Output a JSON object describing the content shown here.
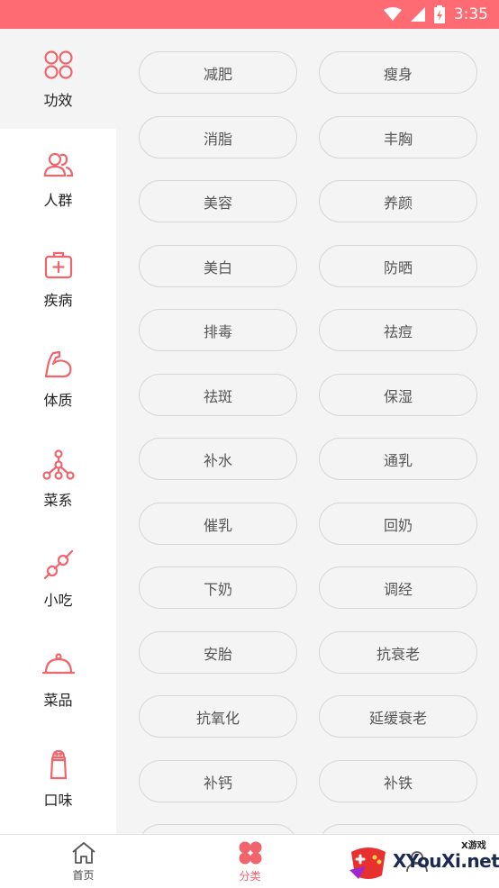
{
  "status_bar": {
    "time": "3:35"
  },
  "sidebar": {
    "items": [
      {
        "label": "功效",
        "icon": "four-circles-icon",
        "active": true
      },
      {
        "label": "人群",
        "icon": "people-icon"
      },
      {
        "label": "疾病",
        "icon": "medical-kit-icon"
      },
      {
        "label": "体质",
        "icon": "muscle-arm-icon"
      },
      {
        "label": "菜系",
        "icon": "tree-network-icon"
      },
      {
        "label": "小吃",
        "icon": "skewer-icon"
      },
      {
        "label": "菜品",
        "icon": "cloche-icon"
      },
      {
        "label": "口味",
        "icon": "salt-shaker-icon"
      }
    ]
  },
  "tags": [
    "减肥",
    "瘦身",
    "消脂",
    "丰胸",
    "美容",
    "养颜",
    "美白",
    "防晒",
    "排毒",
    "祛痘",
    "祛斑",
    "保湿",
    "补水",
    "通乳",
    "催乳",
    "回奶",
    "下奶",
    "调经",
    "安胎",
    "抗衰老",
    "抗氧化",
    "延缓衰老",
    "补钙",
    "补铁"
  ],
  "tab_bar": {
    "tabs": [
      {
        "label": "首页",
        "icon": "home-icon"
      },
      {
        "label": "分类",
        "icon": "category-clover-icon",
        "active": true
      },
      {
        "label": "",
        "icon": "profile-icon"
      }
    ]
  },
  "watermark": {
    "text": "XYouXi.net",
    "sub": "X游戏"
  },
  "colors": {
    "accent": "#ff6b72",
    "icon_pink": "#f0646c",
    "tag_border": "#d6d6d6"
  }
}
